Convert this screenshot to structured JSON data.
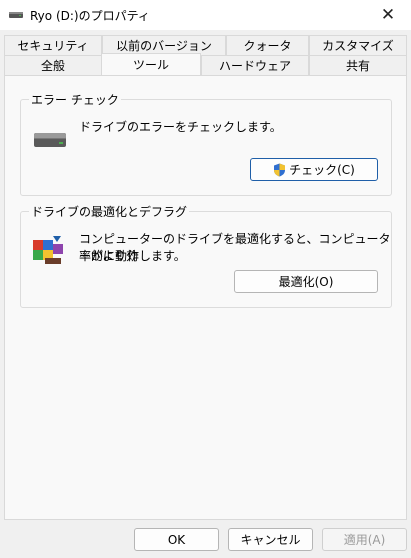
{
  "window": {
    "title": "Ryo (D:)のプロパティ",
    "close_glyph": "✕"
  },
  "tabs": {
    "row1": [
      {
        "label": "セキュリティ"
      },
      {
        "label": "以前のバージョン"
      },
      {
        "label": "クォータ"
      },
      {
        "label": "カスタマイズ"
      }
    ],
    "row2": [
      {
        "label": "全般"
      },
      {
        "label": "ツール",
        "active": true
      },
      {
        "label": "ハードウェア"
      },
      {
        "label": "共有"
      }
    ]
  },
  "error_check": {
    "legend": "エラー チェック",
    "description": "ドライブのエラーをチェックします。",
    "button_label": "チェック(C)",
    "icon": "drive-icon",
    "button_icon": "uac-shield-icon"
  },
  "optimize": {
    "legend": "ドライブの最適化とデフラグ",
    "description_line1": "コンピューターのドライブを最適化すると、コンピューターがより効",
    "description_line2": "率的に動作します。",
    "button_label": "最適化(O)",
    "icon": "defrag-icon"
  },
  "footer": {
    "ok_label": "OK",
    "cancel_label": "キャンセル",
    "apply_label": "適用(A)"
  },
  "colors": {
    "accent": "#1f5fa8",
    "window_bg": "#f0f0f0",
    "panel_bg": "#f9f9f9"
  }
}
